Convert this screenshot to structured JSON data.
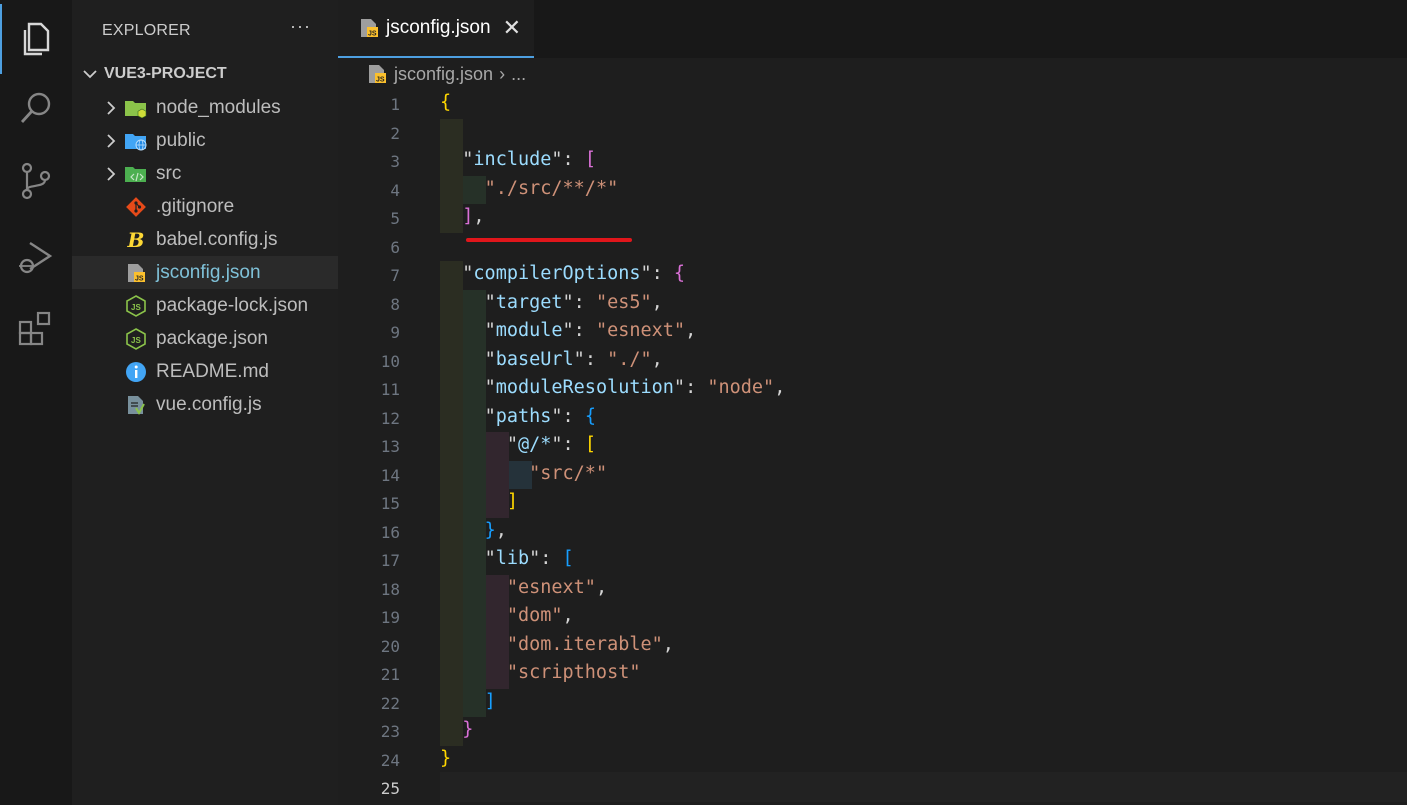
{
  "activity_bar": {
    "items": [
      {
        "icon": "explorer-icon",
        "active": true
      },
      {
        "icon": "search-icon"
      },
      {
        "icon": "source-control-icon"
      },
      {
        "icon": "run-debug-icon"
      },
      {
        "icon": "extensions-icon"
      }
    ]
  },
  "sidebar": {
    "title": "EXPLORER",
    "more_label": "···",
    "project": "VUE3-PROJECT",
    "items": [
      {
        "label": "node_modules",
        "type": "folder",
        "icon": "node-modules-folder-icon",
        "color": "#8bc34a"
      },
      {
        "label": "public",
        "type": "folder",
        "icon": "public-folder-icon",
        "color": "#42a5f5"
      },
      {
        "label": "src",
        "type": "folder",
        "icon": "src-folder-icon",
        "color": "#4caf50"
      },
      {
        "label": ".gitignore",
        "type": "file",
        "icon": "git-icon",
        "color": "#e64a19"
      },
      {
        "label": "babel.config.js",
        "type": "file",
        "icon": "babel-icon",
        "color": "#fdd835"
      },
      {
        "label": "jsconfig.json",
        "type": "file",
        "icon": "jsconfig-icon",
        "color": "#fbc02d",
        "selected": true
      },
      {
        "label": "package-lock.json",
        "type": "file",
        "icon": "nodejs-icon",
        "color": "#8bc34a"
      },
      {
        "label": "package.json",
        "type": "file",
        "icon": "nodejs-icon",
        "color": "#8bc34a"
      },
      {
        "label": "README.md",
        "type": "file",
        "icon": "info-icon",
        "color": "#42a5f5"
      },
      {
        "label": "vue.config.js",
        "type": "file",
        "icon": "vue-config-icon",
        "color": "#8bc34a"
      }
    ]
  },
  "editor": {
    "tab": {
      "label": "jsconfig.json",
      "close": "✕"
    },
    "breadcrumb": {
      "file": "jsconfig.json",
      "separator": "›",
      "more": "..."
    },
    "current_line": 25,
    "lines": [
      {
        "n": "1"
      },
      {
        "n": "2"
      },
      {
        "n": "3"
      },
      {
        "n": "4"
      },
      {
        "n": "5"
      },
      {
        "n": "6"
      },
      {
        "n": "7"
      },
      {
        "n": "8"
      },
      {
        "n": "9"
      },
      {
        "n": "10"
      },
      {
        "n": "11"
      },
      {
        "n": "12"
      },
      {
        "n": "13"
      },
      {
        "n": "14"
      },
      {
        "n": "15"
      },
      {
        "n": "16"
      },
      {
        "n": "17"
      },
      {
        "n": "18"
      },
      {
        "n": "19"
      },
      {
        "n": "20"
      },
      {
        "n": "21"
      },
      {
        "n": "22"
      },
      {
        "n": "23"
      },
      {
        "n": "24"
      },
      {
        "n": "25"
      }
    ],
    "code": {
      "l1": {
        "b": "{"
      },
      "l3": {
        "k": "include",
        "b": "["
      },
      "l4": {
        "s": "./src/**/*"
      },
      "l5": {
        "b": "]"
      },
      "l7": {
        "k": "compilerOptions",
        "b": "{"
      },
      "l8": {
        "k": "target",
        "s": "es5"
      },
      "l9": {
        "k": "module",
        "s": "esnext"
      },
      "l10": {
        "k": "baseUrl",
        "s": "./"
      },
      "l11": {
        "k": "moduleResolution",
        "s": "node"
      },
      "l12": {
        "k": "paths",
        "b": "{"
      },
      "l13": {
        "k": "@/*",
        "b": "["
      },
      "l14": {
        "s": "src/*"
      },
      "l15": {
        "b": "]"
      },
      "l16": {
        "b": "}"
      },
      "l17": {
        "k": "lib",
        "b": "["
      },
      "l18": {
        "s": "esnext"
      },
      "l19": {
        "s": "dom"
      },
      "l20": {
        "s": "dom.iterable"
      },
      "l21": {
        "s": "scripthost"
      },
      "l22": {
        "b": "]"
      },
      "l23": {
        "b": "}"
      },
      "l24": {
        "b": "}"
      }
    },
    "annotation_color": "#e0161b"
  },
  "colors": {
    "accent": "#4d9fe0",
    "key": "#9cdcfe",
    "string": "#ce9178"
  }
}
